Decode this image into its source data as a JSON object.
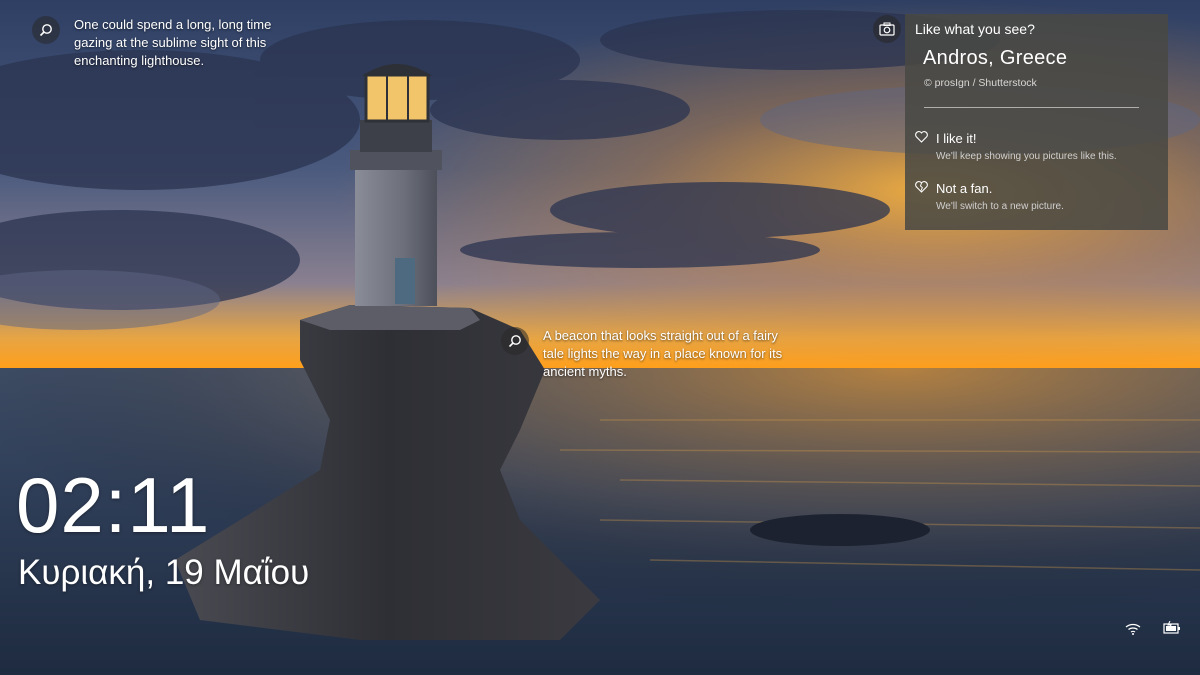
{
  "spotlight": {
    "hotspot_top": {
      "text": "One could spend a long, long time gazing at the sublime sight of this enchanting lighthouse."
    },
    "hotspot_middle": {
      "text": "A beacon that looks straight out of a fairy tale lights the way in a place known for its ancient myths."
    },
    "panel": {
      "heading": "Like what you see?",
      "location": "Andros, Greece",
      "credit": "© prosIgn / Shutterstock",
      "like": {
        "title": "I like it!",
        "description": "We'll keep showing you pictures like this."
      },
      "dislike": {
        "title": "Not a fan.",
        "description": "We'll switch to a new picture."
      }
    }
  },
  "lockscreen": {
    "time": "02:11",
    "date": "Κυριακή, 19 Μαΐου"
  },
  "status_icons": [
    "network-icon",
    "battery-icon"
  ],
  "colors": {
    "panel_bg": "#484844",
    "text": "#ffffff"
  }
}
